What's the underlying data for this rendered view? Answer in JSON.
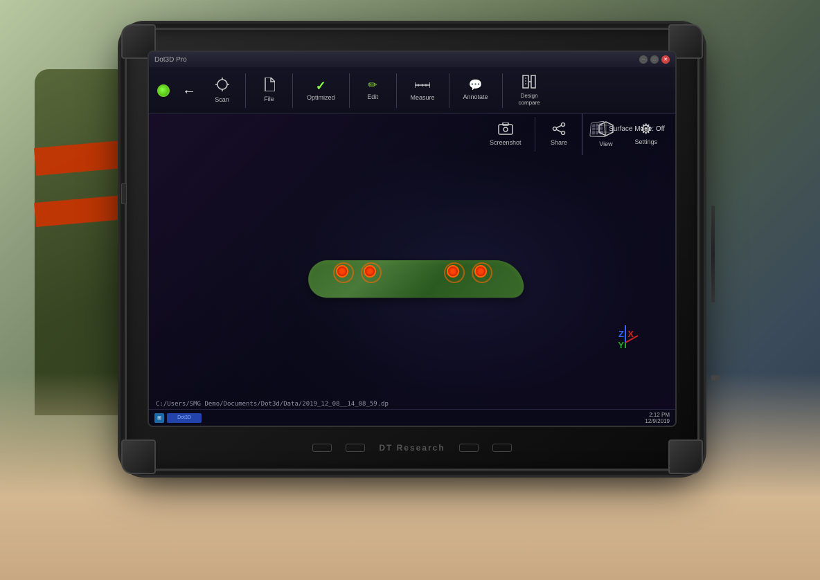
{
  "background": {
    "colors": {
      "sky": "#b8c8a0",
      "ground": "#7a8a6a",
      "dark": "#2a3a4a"
    }
  },
  "tablet": {
    "brand": "DT Research",
    "title_bar": {
      "app_name": "Dot3D Pro",
      "window_controls": [
        "minimize",
        "maximize",
        "close"
      ]
    },
    "toolbar": {
      "back_label": "←",
      "items": [
        {
          "id": "scan",
          "label": "Scan",
          "icon": "⊙"
        },
        {
          "id": "file",
          "label": "File",
          "icon": "📄"
        },
        {
          "id": "optimized",
          "label": "Optimized",
          "icon": "✓"
        },
        {
          "id": "edit",
          "label": "Edit",
          "icon": "✏"
        },
        {
          "id": "measure",
          "label": "Measure",
          "icon": "📏"
        },
        {
          "id": "annotate",
          "label": "Annotate",
          "icon": "💬"
        },
        {
          "id": "design_compare",
          "label": "Design\ncompare",
          "icon": "⊞"
        }
      ]
    },
    "toolbar2": {
      "items": [
        {
          "id": "screenshot",
          "label": "Screenshot",
          "icon": "🖼"
        },
        {
          "id": "share",
          "label": "Share",
          "icon": "⋈"
        },
        {
          "id": "view",
          "label": "View",
          "icon": "◇"
        },
        {
          "id": "settings",
          "label": "Settings",
          "icon": "⚙"
        }
      ]
    },
    "surface_mode": {
      "label": "Surface Mode: Off"
    },
    "scan_object": {
      "file_path": "C:/Users/SMG Demo/Documents/Dot3d/Data/2019_12_08__14_08_59.dp"
    },
    "taskbar": {
      "time": "2:12 PM",
      "date": "12/9/2019"
    },
    "bezel_buttons": [
      "power",
      "asterisk",
      "hash",
      "plus"
    ]
  }
}
